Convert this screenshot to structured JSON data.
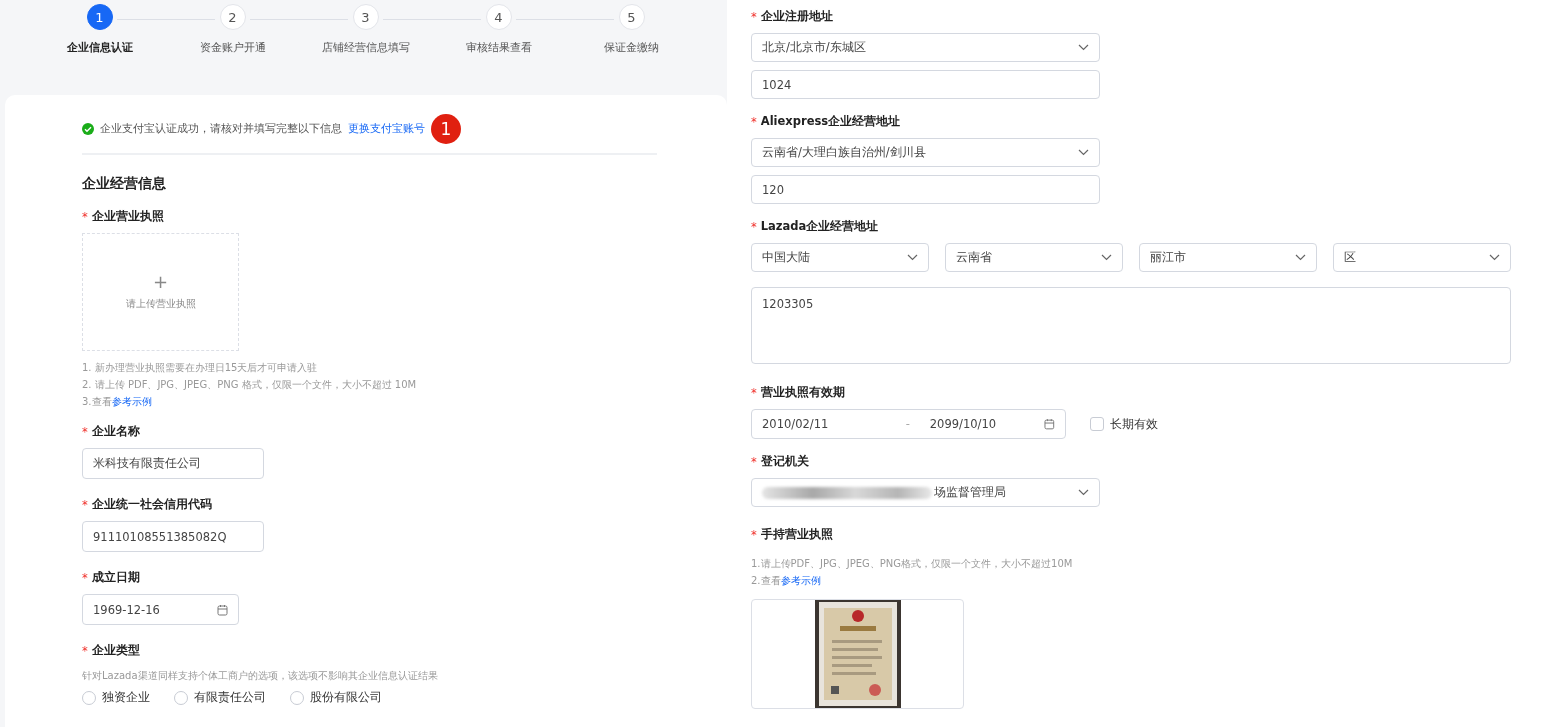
{
  "steps": [
    {
      "number": "1",
      "label": "企业信息认证",
      "selected": true
    },
    {
      "number": "2",
      "label": "资金账户开通",
      "selected": false
    },
    {
      "number": "3",
      "label": "店铺经营信息填写",
      "selected": false
    },
    {
      "number": "4",
      "label": "审核结果查看",
      "selected": false
    },
    {
      "number": "5",
      "label": "保证金缴纳",
      "selected": false
    }
  ],
  "notice": {
    "text": "企业支付宝认证成功，请核对并填写完整以下信息",
    "link": "更换支付宝账号",
    "badge": "1"
  },
  "section_title": "企业经营信息",
  "left_fields": [
    {
      "kind": "upload",
      "required_mark": "*",
      "label": "企业营业执照",
      "plus": "+",
      "placeholder": "请上传营业执照",
      "hints": [
        {
          "text": "1. 新办理营业执照需要在办理日15天后才可申请入驻"
        },
        {
          "text": "2. 请上传 PDF、JPG、JPEG、PNG 格式，仅限一个文件，大小不超过 10M"
        },
        {
          "text": "3.查看",
          "link": "参考示例"
        }
      ]
    },
    {
      "kind": "input",
      "required_mark": "*",
      "label": "企业名称",
      "value": "米科技有限责任公司"
    },
    {
      "kind": "input",
      "required_mark": "*",
      "label": "企业统一社会信用代码",
      "value": "91110108551385082Q"
    },
    {
      "kind": "date",
      "required_mark": "*",
      "label": "成立日期",
      "value": "1969-12-16"
    },
    {
      "kind": "radio",
      "required_mark": "*",
      "label": "企业类型",
      "hint": "针对Lazada渠道同样支持个体工商户的选项，该选项不影响其企业信息认证结果",
      "options": [
        {
          "label": "独资企业",
          "selected": false
        },
        {
          "label": "有限责任公司",
          "selected": false
        },
        {
          "label": "股份有限公司",
          "selected": false
        }
      ]
    }
  ],
  "right_fields": [
    {
      "kind": "address",
      "required_mark": "*",
      "label": "企业注册地址",
      "select": "北京/北京市/东城区",
      "detail": "1024"
    },
    {
      "kind": "address",
      "required_mark": "*",
      "label": "Aliexpress企业经营地址",
      "select": "云南省/大理白族自治州/剑川县",
      "detail": "120"
    },
    {
      "kind": "region",
      "required_mark": "*",
      "label": "Lazada企业经营地址",
      "selects": [
        "中国大陆",
        "云南省",
        "丽江市",
        "区"
      ],
      "detail": "1203305"
    },
    {
      "kind": "daterange",
      "required_mark": "*",
      "label": "营业执照有效期",
      "start": "2010/02/11",
      "separator": "-",
      "end": "2099/10/10",
      "checkbox": {
        "label": "长期有效",
        "checked": false
      }
    },
    {
      "kind": "select",
      "required_mark": "*",
      "label": "登记机关",
      "value": "场监督管理局",
      "redacted": true
    },
    {
      "required_mark": "*",
      "label": "手持营业执照",
      "hints": [
        {
          "text": "1.请上传PDF、JPG、JPEG、PNG格式，仅限一个文件，大小不超过10M"
        },
        {
          "text": "2.查看",
          "link": "参考示例"
        }
      ],
      "image": {
        "kind": "picture"
      }
    }
  ]
}
